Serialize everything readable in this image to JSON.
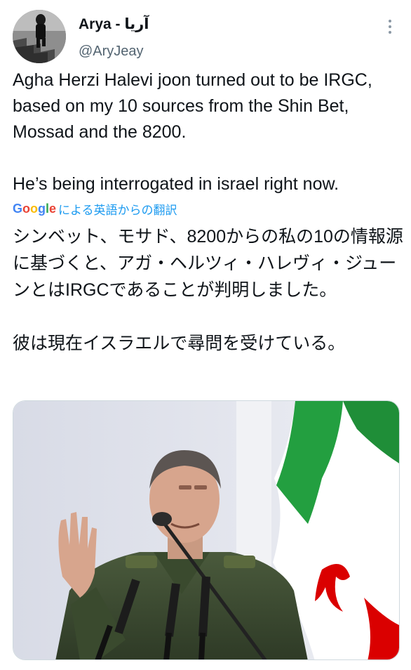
{
  "tweet": {
    "author": {
      "display_name": "Arya - آریا",
      "handle": "@AryJeay"
    },
    "more_icon": "more-vertical-icon",
    "text": "Agha Herzi Halevi joon turned out to be IRGC, based on my 10 sources from the Shin Bet, Mossad and the 8200.\n\nHe’s being interrogated in israel right now.",
    "translation": {
      "provider": "Google",
      "label": "による英語からの翻訳",
      "text": "シンベット、モサド、8200からの私の10の情報源に基づくと、アガ・ヘルツィ・ハレヴィ・ジューンとはIRGCであることが判明しました。\n\n彼は現在イスラエルで尋問を受けている。"
    },
    "media": {
      "kind": "photo",
      "description": "uniformed officer speaking at microphones in front of Iranian flag"
    }
  },
  "colors": {
    "text": "#0f1419",
    "secondary": "#536471",
    "link": "#1d9bf0",
    "flag_green": "#239f40",
    "flag_red": "#da0000"
  }
}
